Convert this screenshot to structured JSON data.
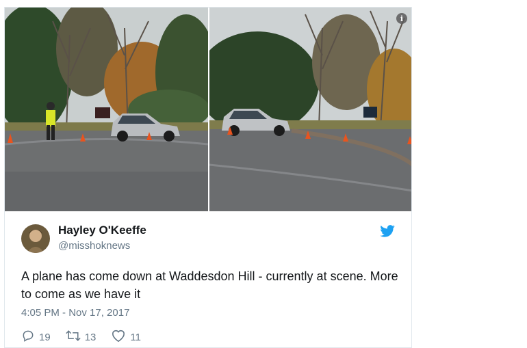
{
  "tweet": {
    "author_name": "Hayley O'Keeffe",
    "author_handle": "@misshoknews",
    "text": "A plane has come down at Waddesdon Hill - currently at scene. More to come as we have it",
    "timestamp": "4:05 PM - Nov 17, 2017",
    "replies": "19",
    "retweets": "13",
    "likes": "11",
    "info_badge": "i"
  },
  "colors": {
    "twitter_blue": "#1da1f2",
    "secondary_text": "#657786",
    "primary_text": "#14171a"
  },
  "icons": {
    "reply": "reply-icon",
    "retweet": "retweet-icon",
    "like": "heart-icon",
    "brand": "twitter-bird-icon",
    "info": "info-icon"
  }
}
